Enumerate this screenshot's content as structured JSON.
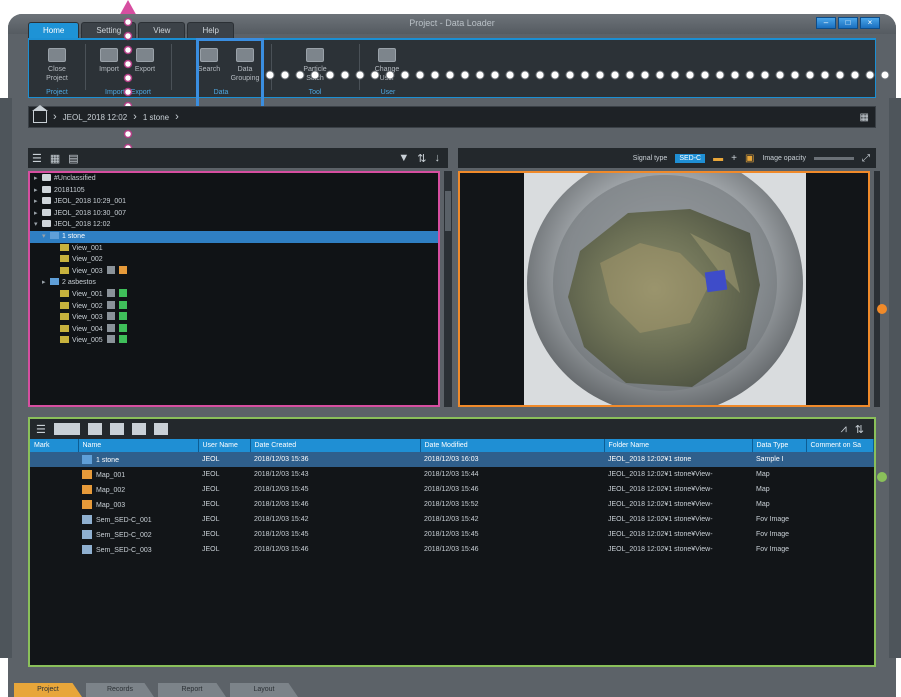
{
  "app": {
    "title": "Project - Data Loader",
    "window_controls": [
      "–",
      "□",
      "×"
    ]
  },
  "ribbon": {
    "tabs": [
      {
        "label": "Home",
        "active": true
      },
      {
        "label": "Setting",
        "active": false
      },
      {
        "label": "View",
        "active": false
      },
      {
        "label": "Help",
        "active": false
      }
    ],
    "groups": [
      {
        "caption": "Project",
        "buttons": [
          "Close Project"
        ]
      },
      {
        "caption": "Import / Export",
        "buttons": [
          "Import",
          "Export"
        ]
      },
      {
        "caption": "Data",
        "buttons": [
          "Search",
          "Data Grouping"
        ]
      },
      {
        "caption": "Tool",
        "buttons": [
          "Particle Stitch"
        ]
      },
      {
        "caption": "User",
        "buttons": [
          "Change User"
        ]
      }
    ]
  },
  "breadcrumb": {
    "items": [
      "JEOL_2018 12:02",
      "1 stone"
    ]
  },
  "image_toolbar": {
    "signal_type_label": "Signal type",
    "signal_type_value": "SED-C",
    "image_opacity_label": "Image opacity"
  },
  "tree": {
    "rows": [
      {
        "label": "#Unclassified",
        "icon": "folder",
        "indent": 1
      },
      {
        "label": "20181105",
        "icon": "folder",
        "indent": 1
      },
      {
        "label": "JEOL_2018 10:29_001",
        "icon": "folder",
        "indent": 1
      },
      {
        "label": "JEOL_2018 10:30_007",
        "icon": "folder",
        "indent": 1
      },
      {
        "label": "JEOL_2018 12:02",
        "icon": "folder",
        "indent": 1
      },
      {
        "label": "1 stone",
        "icon": "group",
        "indent": 2,
        "selected": true
      },
      {
        "label": "View_001",
        "icon": "view",
        "indent": 3
      },
      {
        "label": "View_002",
        "icon": "view",
        "indent": 3
      },
      {
        "label": "View_003",
        "icon": "view",
        "indent": 3,
        "badges": [
          "grey",
          "orange"
        ]
      },
      {
        "label": "2 asbestos",
        "icon": "group",
        "indent": 2
      },
      {
        "label": "View_001",
        "icon": "view",
        "indent": 3,
        "badges": [
          "grey",
          "green"
        ]
      },
      {
        "label": "View_002",
        "icon": "view",
        "indent": 3,
        "badges": [
          "grey",
          "green"
        ]
      },
      {
        "label": "View_003",
        "icon": "view",
        "indent": 3,
        "badges": [
          "grey",
          "green"
        ]
      },
      {
        "label": "View_004",
        "icon": "view",
        "indent": 3,
        "badges": [
          "grey",
          "green"
        ]
      },
      {
        "label": "View_005",
        "icon": "view",
        "indent": 3,
        "badges": [
          "grey",
          "green"
        ]
      }
    ]
  },
  "table": {
    "columns": [
      "Mark",
      "Name",
      "User Name",
      "Date Created",
      "Date Modified",
      "Folder Name",
      "Data Type",
      "Comment on Sa"
    ],
    "rows": [
      {
        "icon": "group",
        "name": "1 stone",
        "user": "JEOL",
        "created": "2018/12/03 15:36",
        "modified": "2018/12/03 16:03",
        "folder": "JEOL_2018 12:02¥1 stone",
        "type": "Sample I",
        "selected": true
      },
      {
        "icon": "map",
        "name": "Map_001",
        "user": "JEOL",
        "created": "2018/12/03 15:43",
        "modified": "2018/12/03 15:44",
        "folder": "JEOL_2018 12:02¥1 stone¥View-",
        "type": "Map"
      },
      {
        "icon": "map",
        "name": "Map_002",
        "user": "JEOL",
        "created": "2018/12/03 15:45",
        "modified": "2018/12/03 15:46",
        "folder": "JEOL_2018 12:02¥1 stone¥View-",
        "type": "Map"
      },
      {
        "icon": "map",
        "name": "Map_003",
        "user": "JEOL",
        "created": "2018/12/03 15:46",
        "modified": "2018/12/03 15:52",
        "folder": "JEOL_2018 12:02¥1 stone¥View-",
        "type": "Map"
      },
      {
        "icon": "image",
        "name": "Sem_SED-C_001",
        "user": "JEOL",
        "created": "2018/12/03 15:42",
        "modified": "2018/12/03 15:42",
        "folder": "JEOL_2018 12:02¥1 stone¥View-",
        "type": "Fov Image"
      },
      {
        "icon": "image",
        "name": "Sem_SED-C_002",
        "user": "JEOL",
        "created": "2018/12/03 15:45",
        "modified": "2018/12/03 15:45",
        "folder": "JEOL_2018 12:02¥1 stone¥View-",
        "type": "Fov Image"
      },
      {
        "icon": "image",
        "name": "Sem_SED-C_003",
        "user": "JEOL",
        "created": "2018/12/03 15:46",
        "modified": "2018/12/03 15:46",
        "folder": "JEOL_2018 12:02¥1 stone¥View-",
        "type": "Fov Image"
      }
    ]
  },
  "bottom_tabs": [
    {
      "label": "Project",
      "active": true
    },
    {
      "label": "Records",
      "active": false
    },
    {
      "label": "Report",
      "active": false
    },
    {
      "label": "Layout",
      "active": false
    }
  ],
  "colors": {
    "accent_blue": "#1f8fd4",
    "tree_callout": "#d64ea0",
    "image_callout": "#f08a2a",
    "table_callout": "#8ac05a",
    "ribbon_callout": "#3a8ee0"
  }
}
